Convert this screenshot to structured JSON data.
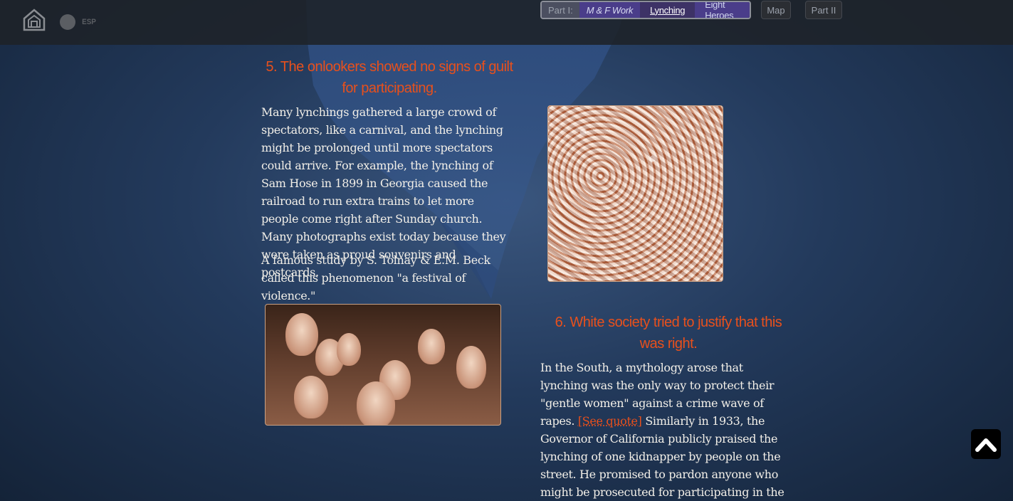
{
  "topbar": {
    "lang_label": "ESP",
    "nav": {
      "part_label": "Part I:",
      "tabs": [
        {
          "label": "M & F Work"
        },
        {
          "label": "Lynching"
        },
        {
          "label": "Eight Heroes"
        }
      ],
      "map_label": "Map",
      "part2_label": "Part II"
    }
  },
  "content": {
    "section5": {
      "heading": "5. The onlookers showed no signs of guilt for participating.",
      "paragraph1": "Many lynchings gathered a large crowd of spectators, like a carnival, and the lynching might be prolonged until more spectators could arrive. For example, the lynching of Sam Hose in 1899 in Georgia caused the railroad to run extra trains to let more people come right after Sunday church. Many photographs exist today because they were taken as proud souvenirs and postcards.",
      "paragraph2": "A famous study by S. Tolnay & E.M. Beck called this phenomenon \"a festival of violence.\""
    },
    "section6": {
      "heading": "6. White society tried to justify that this was right.",
      "paragraph_start": "In the South, a mythology arose that lynching was the only way to protect their \"gentle women\" against a crime wave of rapes.",
      "quote_link": "[See quote]",
      "paragraph_end": "Similarly in 1933, the Governor of California publicly praised the lynching of one kidnapper by people on the street. He promised to pardon anyone who might be prosecuted for participating in the mob."
    }
  },
  "colors": {
    "heading": "#e8501c",
    "body_text": "#f2efe8",
    "background": "#233a5c"
  },
  "icons": {
    "home": "house-icon",
    "scroll_top": "chevron-up-icon"
  }
}
